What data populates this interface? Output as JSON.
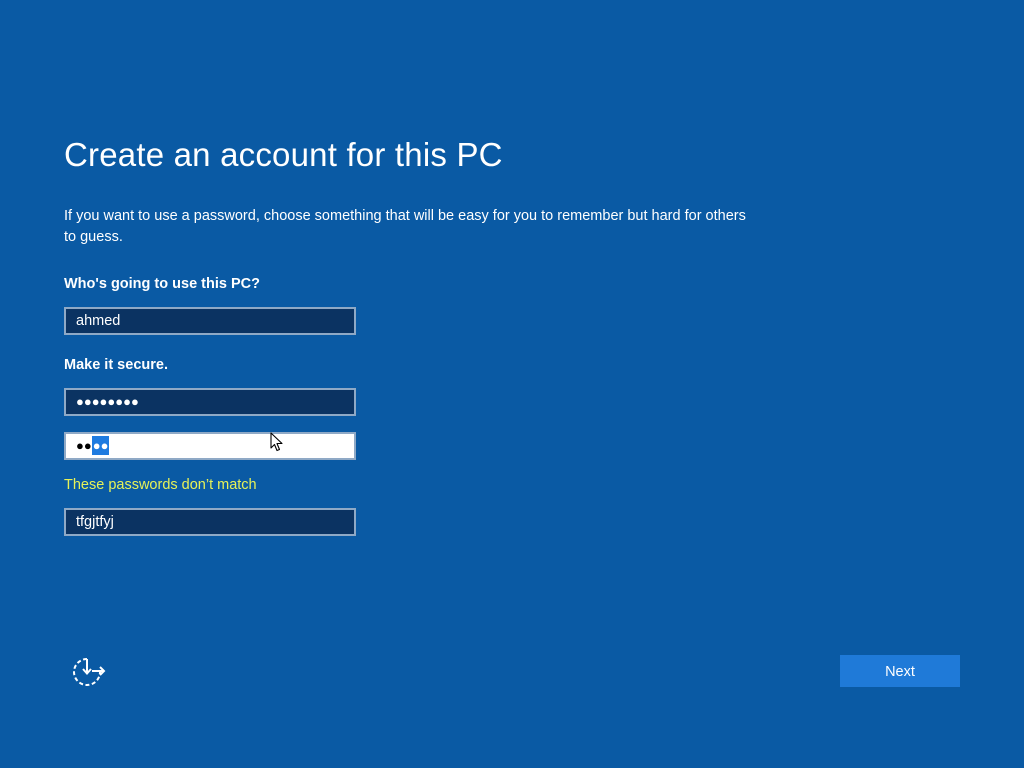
{
  "header": {
    "title": "Create an account for this PC"
  },
  "description": "If you want to use a password, choose something that will be easy for you to remember but hard for others to guess.",
  "form": {
    "username_label": "Who's going to use this PC?",
    "username_value": "ahmed",
    "secure_label": "Make it secure.",
    "password_masked": "●●●●●●●●",
    "confirm_masked_plain": "●●",
    "confirm_masked_selected": "●●",
    "error_text": "These passwords don’t match",
    "hint_value": "tfgjtfyj"
  },
  "footer": {
    "ease_of_access_icon": "ease-of-access-icon",
    "next_label": "Next"
  },
  "colors": {
    "background": "#0a5aa4",
    "field_background": "#0b3362",
    "error": "#e7f258",
    "button": "#1f7ad8",
    "selection": "#1e7be0"
  }
}
